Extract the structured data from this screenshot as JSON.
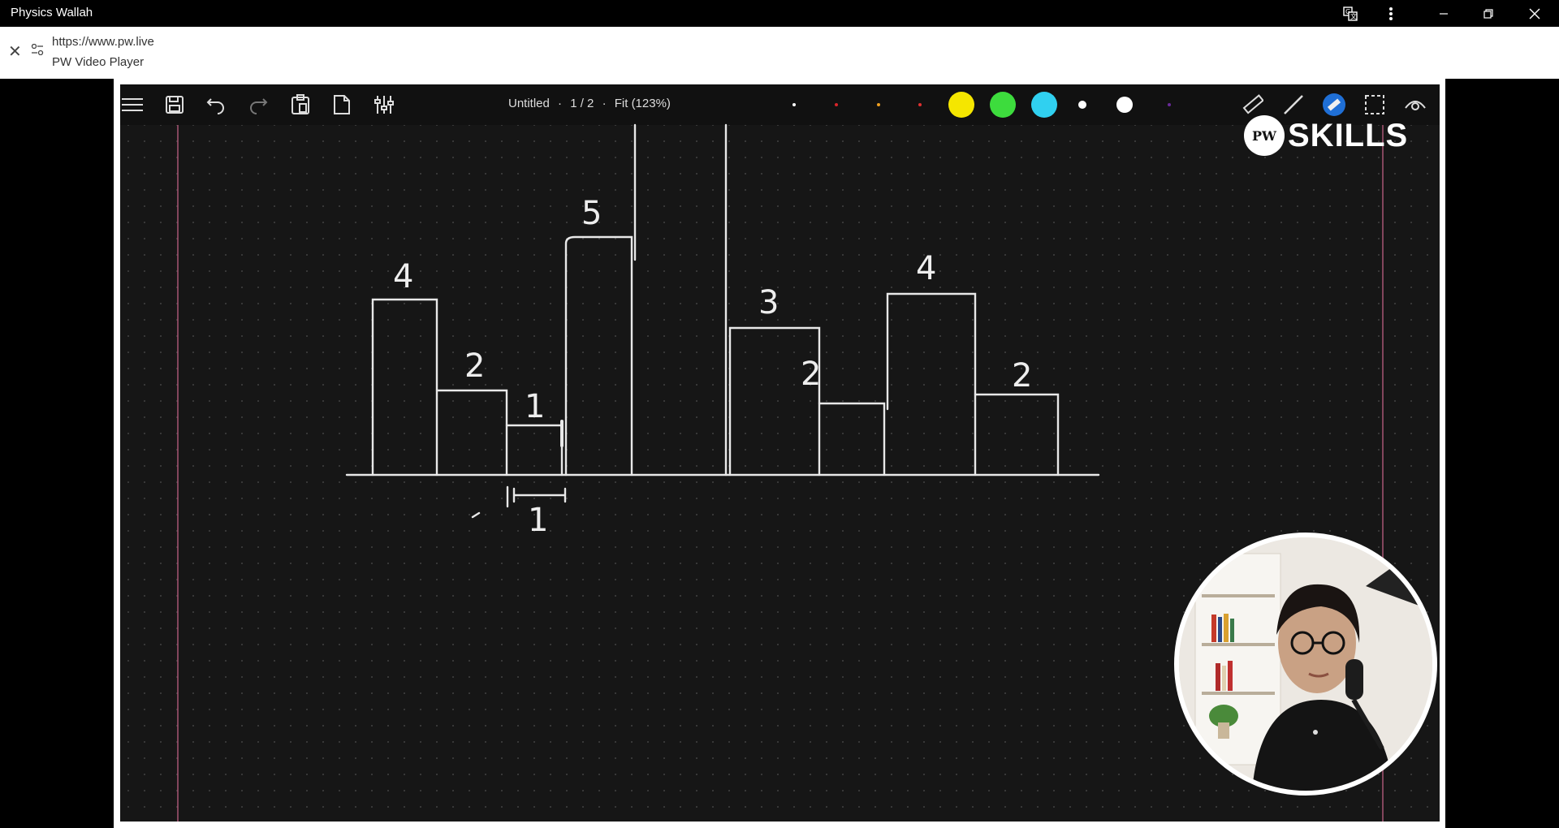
{
  "window": {
    "title": "Physics Wallah",
    "buttons": [
      "translate-icon",
      "more-vert-icon",
      "minimize-icon",
      "restore-icon",
      "close-icon"
    ]
  },
  "urlbar": {
    "url": "https://www.pw.live",
    "subtitle": "PW Video Player"
  },
  "toolbar": {
    "tools": [
      "menu-icon",
      "save-icon",
      "undo-icon",
      "redo-icon",
      "paste-icon",
      "page-icon",
      "settings-sliders-icon"
    ],
    "doc_title": "Untitled",
    "page": "1 / 2",
    "zoom": "Fit (123%)",
    "pen_colors": [
      "#ffffff",
      "#d9252a",
      "#f0a020",
      "#e03030",
      "#f5e600",
      "#3ddc3d",
      "#30d0f0",
      "#ffffff",
      "#ffffff",
      "#6a2a9a"
    ],
    "right_tools": [
      "ruler-icon",
      "line-icon",
      "highlighter-icon",
      "select-icon",
      "eye-icon"
    ]
  },
  "brand": {
    "logo": "PW",
    "text": "SKILLS"
  },
  "board_labels": [
    "4",
    "2",
    "1",
    "5",
    "3",
    "2",
    "4",
    "2",
    "1"
  ]
}
